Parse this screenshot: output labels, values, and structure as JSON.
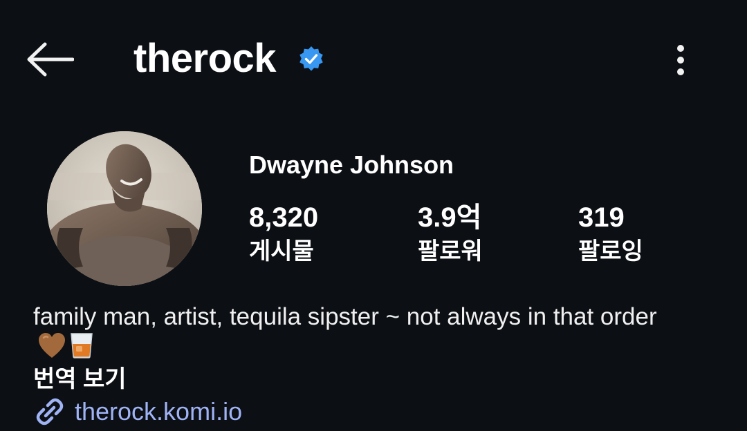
{
  "header": {
    "back_icon": "arrow-left-icon",
    "username": "therock",
    "verified_icon": "verified-badge-icon",
    "more_icon": "more-vertical-icon"
  },
  "profile": {
    "full_name": "Dwayne Johnson",
    "stats": [
      {
        "value": "8,320",
        "label": "게시물"
      },
      {
        "value": "3.9억",
        "label": "팔로워"
      },
      {
        "value": "319",
        "label": "팔로잉"
      }
    ],
    "bio_text": "family man, artist, tequila sipster ~ not always in that order",
    "bio_emojis": [
      "brown-heart-icon",
      "tumbler-glass-icon"
    ],
    "translate_label": "번역 보기",
    "link_icon": "link-icon",
    "link_text": "therock.komi.io"
  },
  "colors": {
    "background": "#0c0f14",
    "verified": "#3897f0",
    "link": "#9fb3f5",
    "text": "#ffffff"
  }
}
